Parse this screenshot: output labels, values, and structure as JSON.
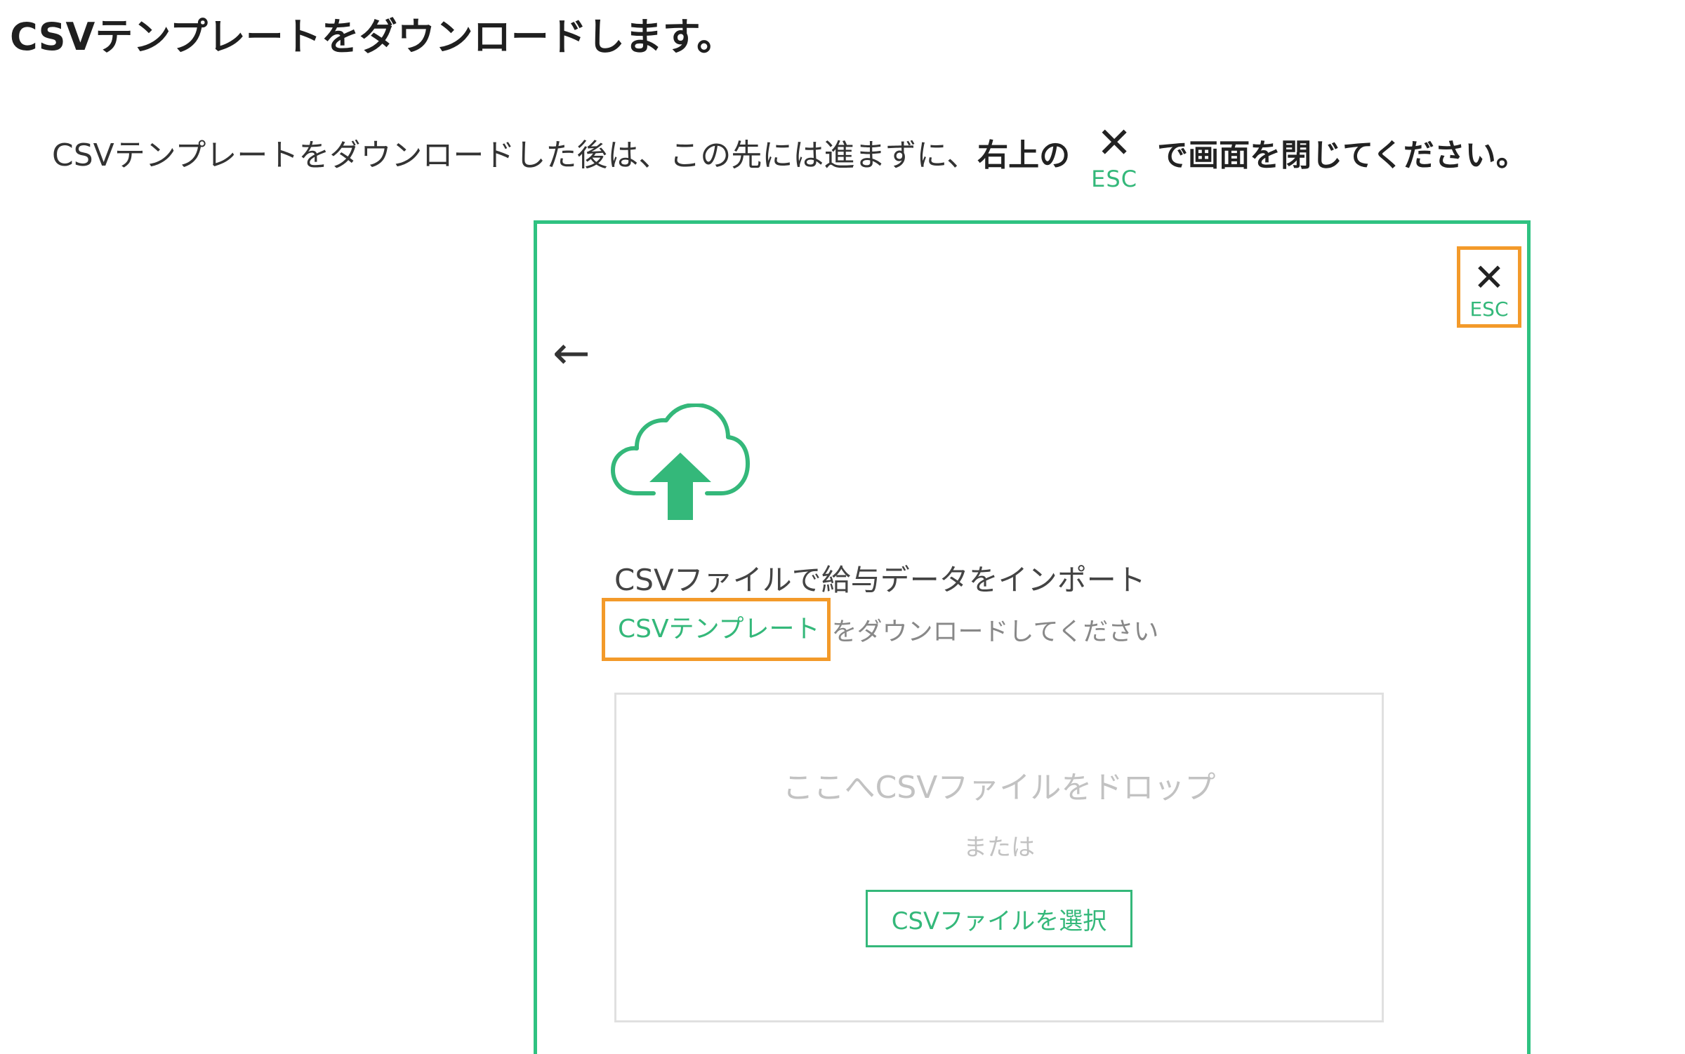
{
  "heading": "CSVテンプレートをダウンロードします。",
  "instruction": {
    "prefix": "CSVテンプレートをダウンロードした後は、この先には進まずに、",
    "bold_before": "右上の",
    "close_symbol": "✕",
    "esc_label": "ESC",
    "bold_after": "で画面を閉じてください。"
  },
  "dialog": {
    "close_symbol": "✕",
    "esc_label": "ESC",
    "back_arrow": "←",
    "title": "CSVファイルで給与データをインポート",
    "template_link": "CSVテンプレート",
    "template_rest": "をダウンロードしてください",
    "dropzone": {
      "drop_text": "ここへCSVファイルをドロップ",
      "or_text": "または",
      "select_button": "CSVファイルを選択"
    }
  },
  "colors": {
    "accent_green": "#34b87a",
    "frame_green": "#2fc281",
    "highlight_orange": "#f39a2a"
  },
  "icons": {
    "upload": "cloud-upload-icon",
    "close": "close-icon",
    "back": "back-arrow-icon"
  }
}
